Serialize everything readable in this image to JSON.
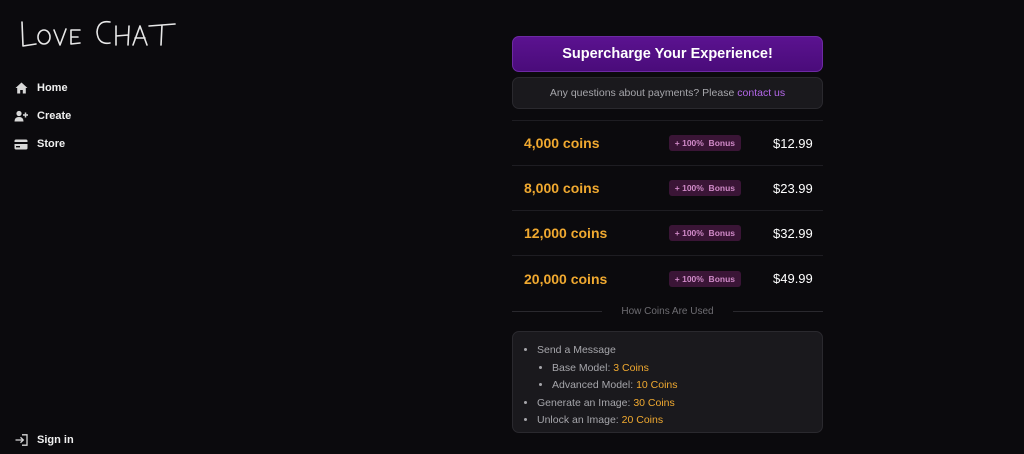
{
  "brand": {
    "name": "LOVE CHAT"
  },
  "sidebar": {
    "items": [
      {
        "label": "Home",
        "icon": "home-icon"
      },
      {
        "label": "Create",
        "icon": "add-user-icon"
      },
      {
        "label": "Store",
        "icon": "card-icon"
      }
    ],
    "signin": {
      "label": "Sign in",
      "icon": "sign-in-icon"
    }
  },
  "store": {
    "cta_label": "Supercharge Your Experience!",
    "contact_text": "Any questions about payments? Please",
    "contact_link": "contact us",
    "packs": [
      {
        "coins": "4,000 coins",
        "bonus": "+ 100%  Bonus",
        "price": "$12.99"
      },
      {
        "coins": "8,000 coins",
        "bonus": "+ 100%  Bonus",
        "price": "$23.99"
      },
      {
        "coins": "12,000 coins",
        "bonus": "+ 100%  Bonus",
        "price": "$32.99"
      },
      {
        "coins": "20,000 coins",
        "bonus": "+ 100%  Bonus",
        "price": "$49.99"
      }
    ],
    "usage_heading": "How Coins Are Used",
    "usage": {
      "send_message": "Send a Message",
      "base_model_label": "Base Model:",
      "base_model_value": "3 Coins",
      "advanced_model_label": "Advanced Model:",
      "advanced_model_value": "10 Coins",
      "generate_image_label": "Generate an Image:",
      "generate_image_value": "30 Coins",
      "unlock_image_label": "Unlock an Image:",
      "unlock_image_value": "20 Coins"
    }
  },
  "colors": {
    "accent": "#4a0c7a",
    "coin": "#f0a930",
    "link": "#b367e8",
    "background": "#0b0a0d"
  }
}
